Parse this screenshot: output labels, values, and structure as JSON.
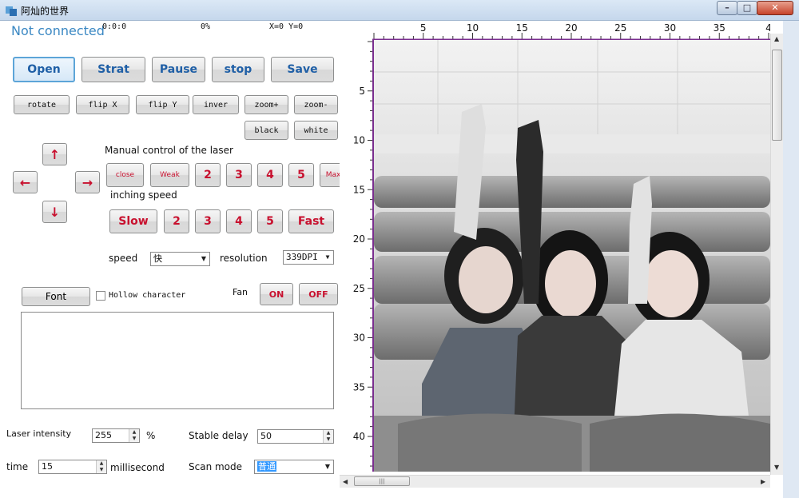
{
  "window": {
    "title": "阿灿的世界"
  },
  "status": {
    "connection": "Not connected",
    "time": "0:0:0",
    "progress": "0%",
    "coords": "X=0 Y=0"
  },
  "toolbar": {
    "open": "Open",
    "start": "Strat",
    "pause": "Pause",
    "stop": "stop",
    "save": "Save"
  },
  "image_tools": {
    "rotate": "rotate",
    "flip_x": "flip X",
    "flip_y": "flip Y",
    "invert": "inver",
    "zoom_in": "zoom+",
    "zoom_out": "zoom-",
    "black": "black",
    "white": "white"
  },
  "manual": {
    "label": "Manual control of the laser",
    "arrows": {
      "up": "↑",
      "down": "↓",
      "left": "←",
      "right": "→"
    },
    "power_buttons": [
      "close",
      "Weak",
      "2",
      "3",
      "4",
      "5",
      "Max"
    ],
    "inching_label": "inching speed",
    "speed_buttons": [
      "Slow",
      "2",
      "3",
      "4",
      "5",
      "Fast"
    ]
  },
  "settings": {
    "speed_label": "speed",
    "speed_value": "快",
    "resolution_label": "resolution",
    "resolution_value": "339DPI"
  },
  "text_tools": {
    "font_button": "Font",
    "hollow_label": "Hollow character",
    "fan_label": "Fan",
    "fan_on": "ON",
    "fan_off": "OFF"
  },
  "params": {
    "laser_intensity_label": "Laser intensity",
    "laser_intensity_value": "255",
    "laser_intensity_unit": "%",
    "stable_delay_label": "Stable delay",
    "stable_delay_value": "50",
    "time_label": "time",
    "time_value": "15",
    "time_unit": "millisecond",
    "scan_mode_label": "Scan mode",
    "scan_mode_value": "普通"
  },
  "rulers": {
    "top_labels": [
      "5",
      "10",
      "15",
      "20",
      "25",
      "30",
      "35",
      "4"
    ],
    "left_labels": [
      "5",
      "10",
      "15",
      "20",
      "25",
      "30",
      "35",
      "40"
    ]
  },
  "colors": {
    "accent": "#1f5fa6",
    "red": "#c8102e",
    "status": "#3b88c3",
    "ruler": "#7a2e8f"
  }
}
